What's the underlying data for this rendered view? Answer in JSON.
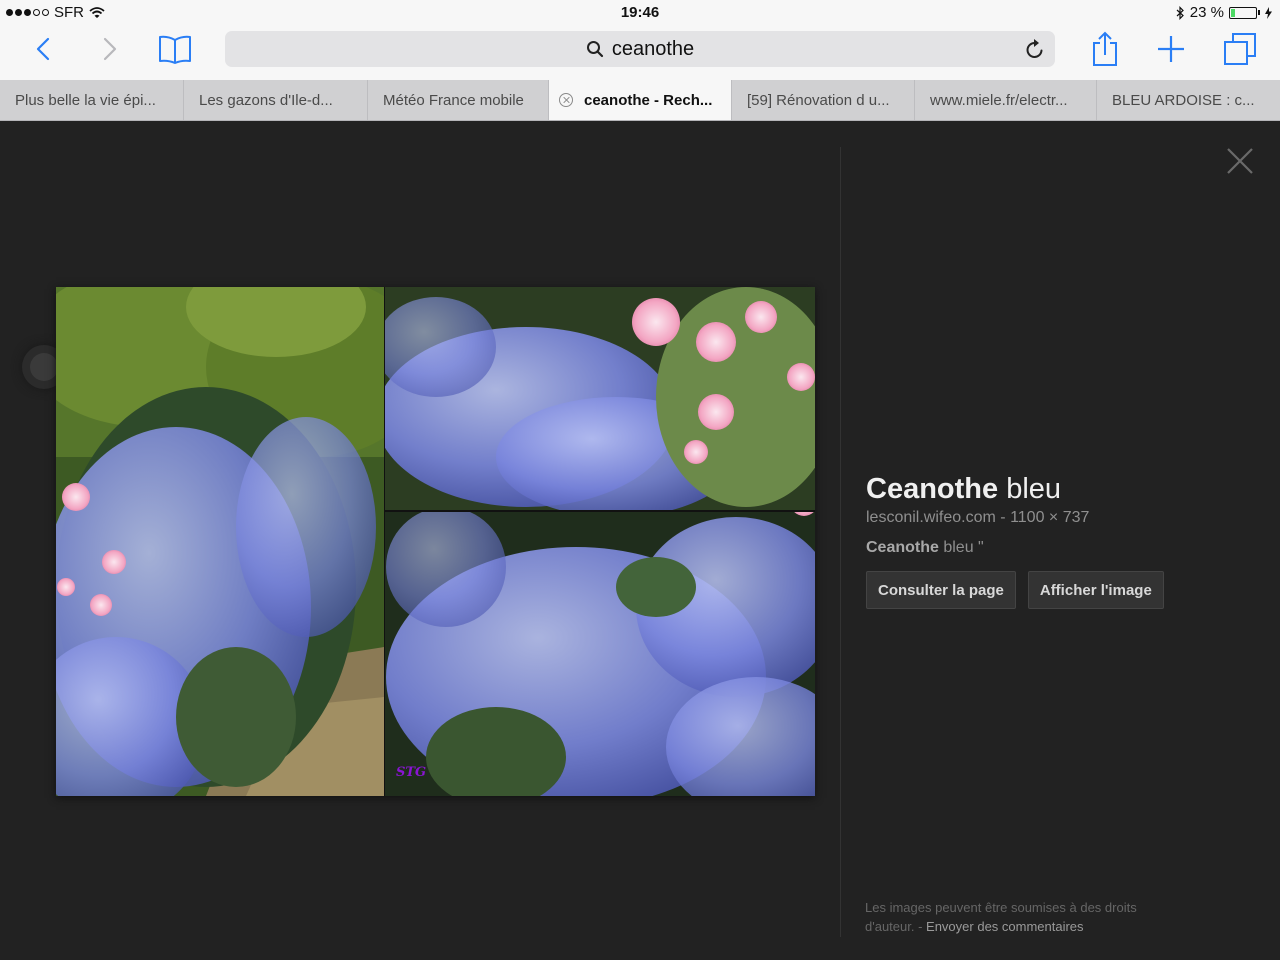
{
  "status_bar": {
    "carrier": "SFR",
    "time": "19:46",
    "battery": "23 %",
    "battery_level": 0.23
  },
  "toolbar": {
    "search_text": "ceanothe"
  },
  "tabs": [
    {
      "label": "Plus belle la vie épi..."
    },
    {
      "label": "Les gazons d'Ile-d..."
    },
    {
      "label": "Météo France mobile"
    },
    {
      "label": "ceanothe - Rech...",
      "active": true
    },
    {
      "label": "[59] Rénovation d u..."
    },
    {
      "label": "www.miele.fr/electr..."
    },
    {
      "label": "BLEU ARDOISE : c..."
    }
  ],
  "image_viewer": {
    "watermark": "STG",
    "title_bold": "Ceanothe",
    "title_rest": " bleu",
    "source": "lesconil.wifeo.com",
    "separator": "-",
    "dimensions": "1100 × 737",
    "desc_bold": "Ceanothe",
    "desc_rest": " bleu \"",
    "visit_button": "Consulter la page",
    "view_button": "Afficher l'image",
    "footer_text": "Les images peuvent être soumises à des droits d'auteur.",
    "footer_separator": " - ",
    "footer_link": "Envoyer des commentaires"
  },
  "colors": {
    "ios_blue": "#2a7ef5",
    "viewer_background": "#222222",
    "battery_green": "#4cd964"
  }
}
